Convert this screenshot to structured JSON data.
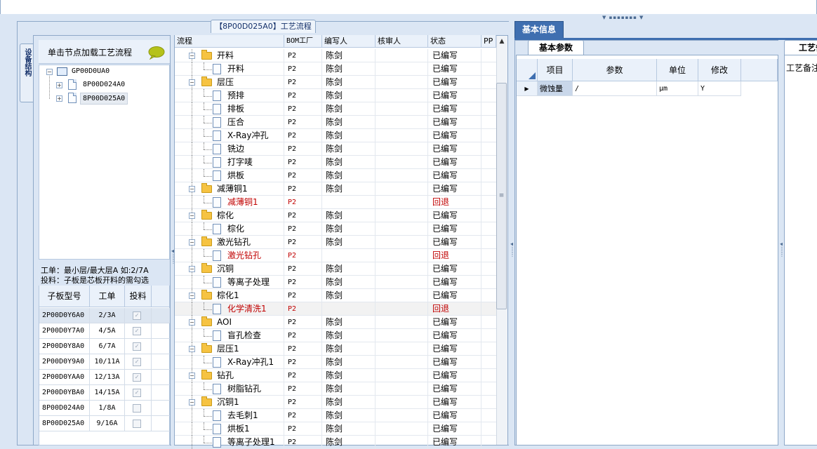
{
  "window": {
    "splitter_grip": "▼ ▪▪▪▪▪▪▪ ▼"
  },
  "left": {
    "flow_tab": "【8P00D025A0】工艺流程",
    "vertical_tab": "设备结构",
    "tree_header": "单击节点加载工艺流程",
    "tree": [
      {
        "label": "GP00D0UA0",
        "level": 0
      },
      {
        "label": "8P00D024A0",
        "level": 1
      },
      {
        "label": "8P00D025A0",
        "level": 1
      }
    ],
    "info_line1": "工单：最小层/最大层A 如:2/7A",
    "info_line2": "投料：子板是芯板开料的需勾选",
    "sub_table": {
      "headers": [
        "子板型号",
        "工单",
        "投料"
      ],
      "rows": [
        {
          "model": "2P00D0Y6A0",
          "order": "2/3A",
          "fed": true
        },
        {
          "model": "2P00D0Y7A0",
          "order": "4/5A",
          "fed": true
        },
        {
          "model": "2P00D0Y8A0",
          "order": "6/7A",
          "fed": true
        },
        {
          "model": "2P00D0Y9A0",
          "order": "10/11A",
          "fed": true
        },
        {
          "model": "2P00D0YAA0",
          "order": "12/13A",
          "fed": true
        },
        {
          "model": "2P00D0YBA0",
          "order": "14/15A",
          "fed": true
        },
        {
          "model": "8P00D024A0",
          "order": "1/8A",
          "fed": false
        },
        {
          "model": "8P00D025A0",
          "order": "9/16A",
          "fed": false
        }
      ]
    }
  },
  "grid": {
    "headers": [
      "流程",
      "BOM工厂",
      "编写人",
      "核审人",
      "状态",
      "PP"
    ],
    "rows": [
      {
        "name": "开料",
        "type": "folder",
        "factory": "P2",
        "writer": "陈剑",
        "status": "已编写"
      },
      {
        "name": "开料",
        "type": "doc",
        "factory": "P2",
        "writer": "陈剑",
        "status": "已编写"
      },
      {
        "name": "层压",
        "type": "folder",
        "factory": "P2",
        "writer": "陈剑",
        "status": "已编写"
      },
      {
        "name": "预排",
        "type": "doc",
        "factory": "P2",
        "writer": "陈剑",
        "status": "已编写"
      },
      {
        "name": "排板",
        "type": "doc",
        "factory": "P2",
        "writer": "陈剑",
        "status": "已编写"
      },
      {
        "name": "压合",
        "type": "doc",
        "factory": "P2",
        "writer": "陈剑",
        "status": "已编写"
      },
      {
        "name": "X-Ray冲孔",
        "type": "doc",
        "factory": "P2",
        "writer": "陈剑",
        "status": "已编写"
      },
      {
        "name": "铣边",
        "type": "doc",
        "factory": "P2",
        "writer": "陈剑",
        "status": "已编写"
      },
      {
        "name": "打字唛",
        "type": "doc",
        "factory": "P2",
        "writer": "陈剑",
        "status": "已编写"
      },
      {
        "name": "烘板",
        "type": "doc",
        "factory": "P2",
        "writer": "陈剑",
        "status": "已编写"
      },
      {
        "name": "减薄铜1",
        "type": "folder",
        "factory": "P2",
        "writer": "陈剑",
        "status": "已编写"
      },
      {
        "name": "减薄铜1",
        "type": "doc",
        "factory": "P2",
        "writer": "",
        "status": "回退",
        "red": true
      },
      {
        "name": "棕化",
        "type": "folder",
        "factory": "P2",
        "writer": "陈剑",
        "status": "已编写"
      },
      {
        "name": "棕化",
        "type": "doc",
        "factory": "P2",
        "writer": "陈剑",
        "status": "已编写"
      },
      {
        "name": "激光钻孔",
        "type": "folder",
        "factory": "P2",
        "writer": "陈剑",
        "status": "已编写"
      },
      {
        "name": "激光钻孔",
        "type": "doc",
        "factory": "P2",
        "writer": "",
        "status": "回退",
        "red": true
      },
      {
        "name": "沉铜",
        "type": "folder",
        "factory": "P2",
        "writer": "陈剑",
        "status": "已编写"
      },
      {
        "name": "等离子处理",
        "type": "doc",
        "factory": "P2",
        "writer": "陈剑",
        "status": "已编写"
      },
      {
        "name": "棕化1",
        "type": "folder",
        "factory": "P2",
        "writer": "陈剑",
        "status": "已编写"
      },
      {
        "name": "化学清洗1",
        "type": "doc",
        "factory": "P2",
        "writer": "",
        "status": "回退",
        "red": true,
        "highlight": true
      },
      {
        "name": "AOI",
        "type": "folder",
        "factory": "P2",
        "writer": "陈剑",
        "status": "已编写"
      },
      {
        "name": "盲孔检查",
        "type": "doc",
        "factory": "P2",
        "writer": "陈剑",
        "status": "已编写"
      },
      {
        "name": "层压1",
        "type": "folder",
        "factory": "P2",
        "writer": "陈剑",
        "status": "已编写"
      },
      {
        "name": "X-Ray冲孔1",
        "type": "doc",
        "factory": "P2",
        "writer": "陈剑",
        "status": "已编写"
      },
      {
        "name": "钻孔",
        "type": "folder",
        "factory": "P2",
        "writer": "陈剑",
        "status": "已编写"
      },
      {
        "name": "树脂钻孔",
        "type": "doc",
        "factory": "P2",
        "writer": "陈剑",
        "status": "已编写"
      },
      {
        "name": "沉铜1",
        "type": "folder",
        "factory": "P2",
        "writer": "陈剑",
        "status": "已编写"
      },
      {
        "name": "去毛刺1",
        "type": "doc",
        "factory": "P2",
        "writer": "陈剑",
        "status": "已编写"
      },
      {
        "name": "烘板1",
        "type": "doc",
        "factory": "P2",
        "writer": "陈剑",
        "status": "已编写"
      },
      {
        "name": "等离子处理1",
        "type": "doc",
        "factory": "P2",
        "writer": "陈剑",
        "status": "已编写"
      }
    ]
  },
  "right": {
    "tab_basic_info": "基本信息",
    "tab_basic_params": "基本参数",
    "tab_process": "工艺备注",
    "process_note_label": "工艺备注",
    "param_headers": [
      "项目",
      "参数",
      "单位",
      "修改"
    ],
    "param_rows": [
      {
        "item": "微蚀量",
        "param": "/",
        "unit": "μm",
        "modify": "Y"
      }
    ]
  },
  "colors": {
    "accent": "#3f6fb0",
    "red_text": "#c00000",
    "border": "#8ea8c8",
    "panel": "#dbe6f4"
  }
}
